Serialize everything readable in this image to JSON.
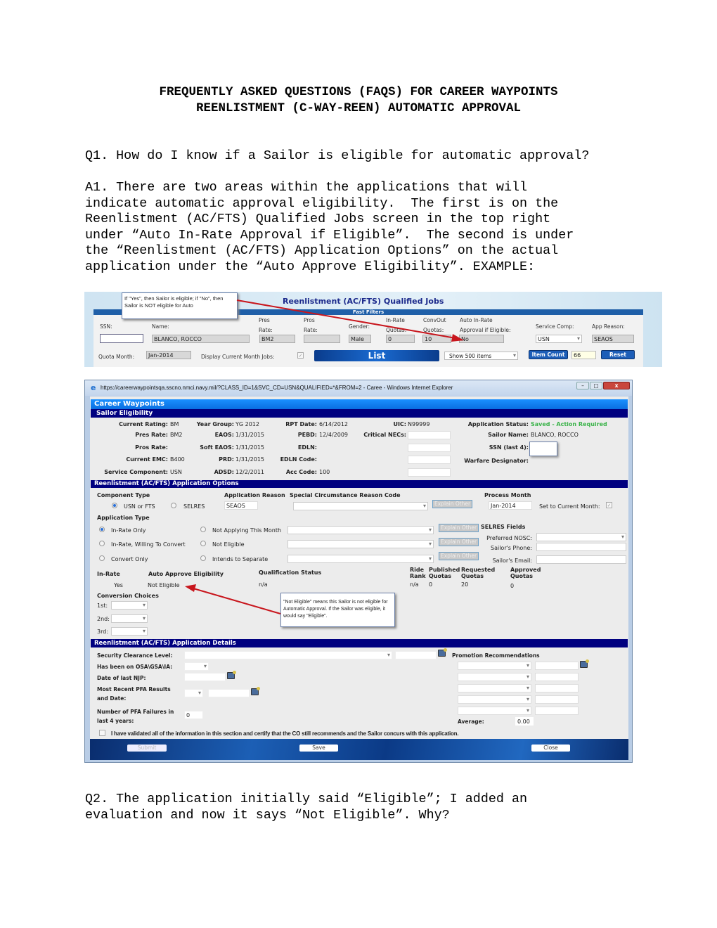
{
  "doc": {
    "title_line1": "FREQUENTLY ASKED QUESTIONS (FAQS) FOR CAREER WAYPOINTS",
    "title_line2": "REENLISTMENT (C-WAY-REEN) AUTOMATIC APPROVAL",
    "q1": "Q1. How do I know if a Sailor is eligible for automatic approval?",
    "a1": "A1. There are two areas within the applications that will\nindicate automatic approval eligibility.  The first is on the\nReenlistment (AC/FTS) Qualified Jobs screen in the top right\nunder “Auto In-Rate Approval if Eligible”.  The second is under\nthe “Reenlistment (AC/FTS) Application Options” on the actual\napplication under the “Auto Approve Eligibility”. EXAMPLE:",
    "q2": "Q2. The application initially said “Eligible”; I added an\nevaluation and now it says “Not Eligible”. Why?"
  },
  "shot1": {
    "callout": "If \"Yes\", then Sailor is eligible; if \"No\", then Sailor is NOT eligible for Auto",
    "title": "Reenlistment (AC/FTS) Qualified Jobs",
    "fast_filters": "Fast Filters",
    "labels": {
      "ssn": "SSN:",
      "name": "Name:",
      "pres1": "Pres",
      "pres2": "Rate:",
      "pros1": "Pros",
      "pros2": "Rate:",
      "gender": "Gender:",
      "inrate1": "In-Rate",
      "inrate2": "Quotas:",
      "conv1": "ConvOut",
      "conv2": "Quotas:",
      "auto1": "Auto In-Rate",
      "auto2": "Approval if Eligible:",
      "service": "Service Comp:",
      "appreason": "App Reason:",
      "quota_month": "Quota Month:",
      "display_current": "Display Current Month Jobs:"
    },
    "values": {
      "ssn": "",
      "name": "BLANCO, ROCCO",
      "pres_rate": "BM2",
      "pros_rate": "",
      "gender": "Male",
      "inrate_quotas": "0",
      "convout_quotas": "10",
      "auto_approval": "No",
      "service_comp": "USN",
      "app_reason": "SEAOS",
      "quota_month": "Jan-2014",
      "item_count": "66"
    },
    "buttons": {
      "list": "List",
      "show_items": "Show 500 items",
      "item_count": "Item Count",
      "reset": "Reset"
    }
  },
  "shot2": {
    "window_title": "https://careerwaypointsqa.sscno.nmci.navy.mil/?CLASS_ID=1&SVC_CD=USN&QUALIFIED=*&FROM=2 - Caree - Windows Internet Explorer",
    "app_title": "Career Waypoints",
    "sailor_eligibility": {
      "header": "Sailor Eligibility",
      "col1": [
        {
          "label": "Current Rating:",
          "value": "BM"
        },
        {
          "label": "Pres Rate:",
          "value": "BM2"
        },
        {
          "label": "Pros Rate:",
          "value": ""
        },
        {
          "label": "Current EMC:",
          "value": "B400"
        },
        {
          "label": "Service Component:",
          "value": "USN"
        }
      ],
      "col2": [
        {
          "label": "Year Group:",
          "value": "YG 2012"
        },
        {
          "label": "EAOS:",
          "value": "1/31/2015"
        },
        {
          "label": "Soft EAOS:",
          "value": "1/31/2015"
        },
        {
          "label": "PRD:",
          "value": "1/31/2015"
        },
        {
          "label": "ADSD:",
          "value": "12/2/2011"
        }
      ],
      "col3": [
        {
          "label": "RPT Date:",
          "value": "6/14/2012"
        },
        {
          "label": "PEBD:",
          "value": "12/4/2009"
        },
        {
          "label": "EDLN:",
          "value": ""
        },
        {
          "label": "EDLN Code:",
          "value": ""
        },
        {
          "label": "Acc Code:",
          "value": "100"
        }
      ],
      "uic_label": "UIC:",
      "uic": "N99999",
      "critical_necs_label": "Critical NECs:",
      "status_label": "Application Status:",
      "status": "Saved - Action Required",
      "status_color": "#3bb34a",
      "sailor_name_label": "Sailor Name:",
      "sailor_name": "BLANCO, ROCCO",
      "ssn_label": "SSN (last 4):",
      "warfare_label": "Warfare Designator:"
    },
    "options": {
      "header": "Reenlistment (AC/FTS) Application Options",
      "component_type": "Component Type",
      "usn_fts": "USN or FTS",
      "selres": "SELRES",
      "application_reason": "Application Reason",
      "application_reason_value": "SEAOS",
      "special_reason": "Special Circumstance Reason Code",
      "explain_other": "Explain Other",
      "process_month": "Process Month",
      "process_month_value": "Jan-2014",
      "set_current": "Set to Current Month:",
      "application_type": "Application Type",
      "types_left": [
        "In-Rate Only",
        "In-Rate, Willing To Convert",
        "Convert Only"
      ],
      "types_right": [
        "Not Applying This Month",
        "Not Eligible",
        "Intends to Separate"
      ],
      "selres_fields": "SELRES Fields",
      "preferred_nosc": "Preferred NOSC:",
      "sailors_phone": "Sailor's Phone:",
      "sailors_email": "Sailor's Email:",
      "in_rate": "In-Rate",
      "in_rate_value": "Yes",
      "auto_approve": "Auto Approve Eligibility",
      "auto_approve_value": "Not Eligible",
      "qualification_status": "Qualification Status",
      "qualification_value": "n/a",
      "ride_rank1": "Ride",
      "ride_rank2": "Rank",
      "ride_rank_value": "n/a",
      "published1": "Published",
      "published2": "Quotas",
      "published_value": "0",
      "requested1": "Requested",
      "requested2": "Quotas",
      "requested_value": "20",
      "approved1": "Approved",
      "approved2": "Quotas",
      "approved_value": "0",
      "conversion_choices": "Conversion Choices",
      "choice1": "1st:",
      "choice2": "2nd:",
      "choice3": "3rd:",
      "callout": "\"Not Eligible\" means this Sailor is not eligible for Automatic Approval.  If the Sailor was eligible, it would say \"Eligible\"."
    },
    "details": {
      "header": "Reenlistment (AC/FTS) Application Details",
      "security": "Security Clearance Level:",
      "osa": "Has been on OSA\\GSA\\IA:",
      "njp": "Date of last NJP:",
      "pfa1": "Most Recent PFA Results",
      "pfa2": "and Date:",
      "pfa_fail1": "Number of PFA Failures in",
      "pfa_fail2": "last 4 years:",
      "pfa_fail_value": "0",
      "promotion": "Promotion Recommendations",
      "average": "Average:",
      "average_value": "0.00",
      "certify": "I have validated all of the information in this section and certify that the CO still recommends and the Sailor concurs with this application."
    },
    "buttons": {
      "submit": "Submit",
      "save": "Save",
      "close": "Close"
    }
  }
}
